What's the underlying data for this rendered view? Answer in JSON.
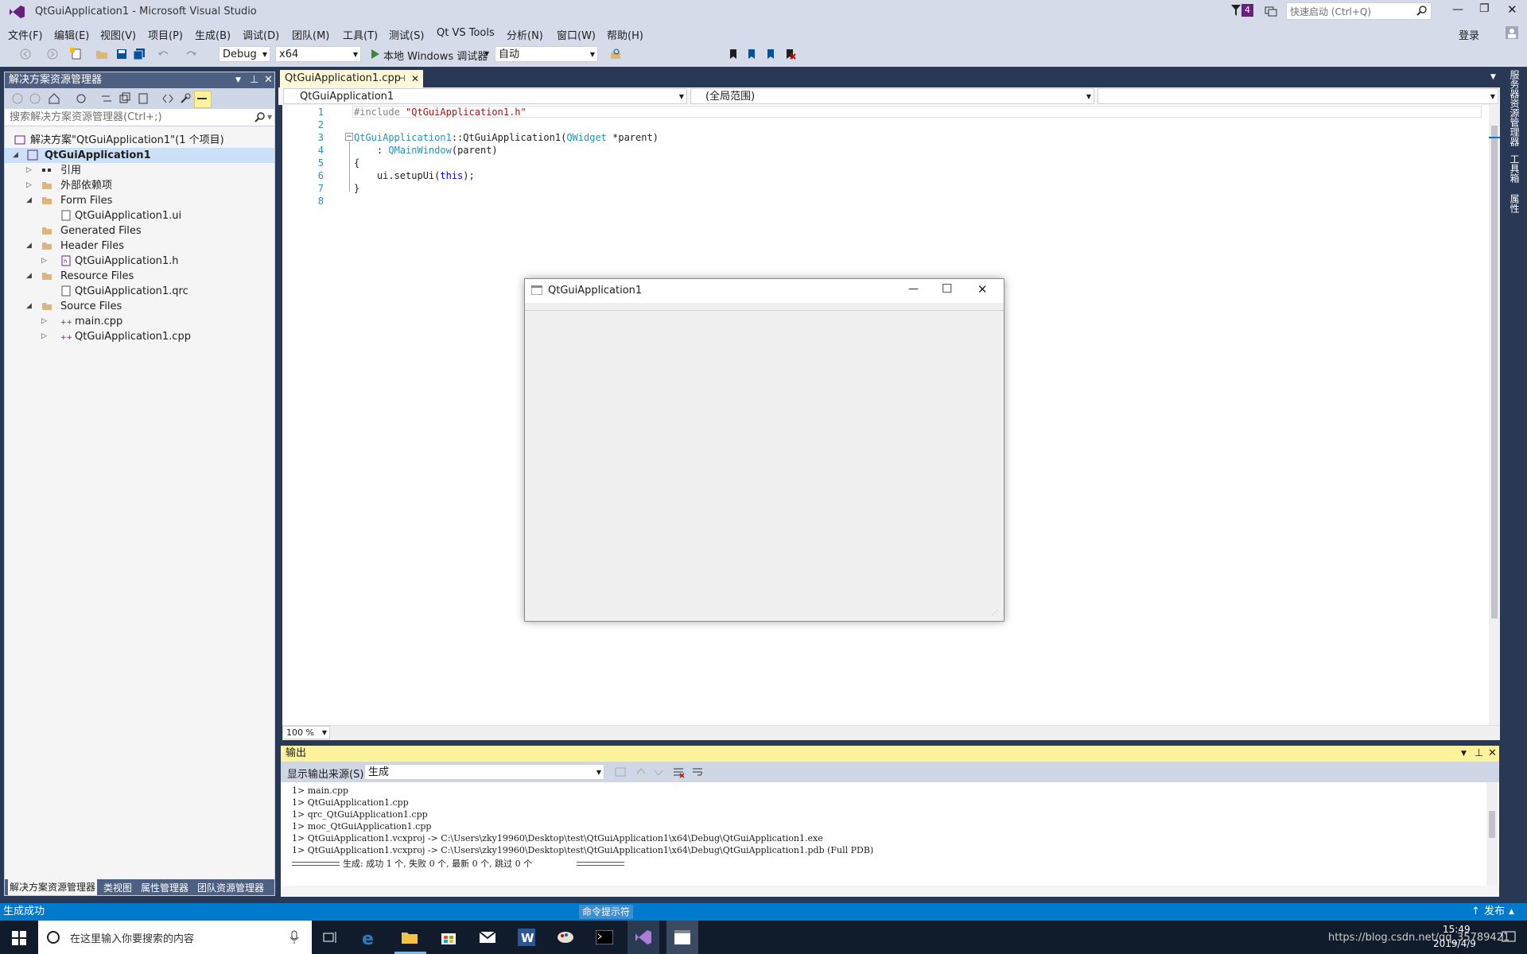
{
  "window": {
    "title": "QtGuiApplication1 - Microsoft Visual Studio",
    "notif_count": "4",
    "quick_launch_placeholder": "快速启动 (Ctrl+Q)",
    "login": "登录"
  },
  "menu": [
    "文件(F)",
    "编辑(E)",
    "视图(V)",
    "项目(P)",
    "生成(B)",
    "调试(D)",
    "团队(M)",
    "工具(T)",
    "测试(S)",
    "Qt VS Tools",
    "分析(N)",
    "窗口(W)",
    "帮助(H)"
  ],
  "toolbar": {
    "config": "Debug",
    "platform": "x64",
    "debugger": "本地 Windows 调试器",
    "auto": "自动"
  },
  "solution_explorer": {
    "title": "解决方案资源管理器",
    "search_placeholder": "搜索解决方案资源管理器(Ctrl+;)",
    "items": [
      {
        "label": "解决方案\"QtGuiApplication1\"(1 个项目)"
      },
      {
        "label": "QtGuiApplication1"
      },
      {
        "label": "引用"
      },
      {
        "label": "外部依赖项"
      },
      {
        "label": "Form Files"
      },
      {
        "label": "QtGuiApplication1.ui"
      },
      {
        "label": "Generated Files"
      },
      {
        "label": "Header Files"
      },
      {
        "label": "QtGuiApplication1.h"
      },
      {
        "label": "Resource Files"
      },
      {
        "label": "QtGuiApplication1.qrc"
      },
      {
        "label": "Source Files"
      },
      {
        "label": "main.cpp"
      },
      {
        "label": "QtGuiApplication1.cpp"
      }
    ],
    "bottom_tabs": [
      "解决方案资源管理器",
      "类视图",
      "属性管理器",
      "团队资源管理器"
    ]
  },
  "editor": {
    "tab_label": "QtGuiApplication1.cpp",
    "nav_project": "QtGuiApplication1",
    "nav_scope": "(全局范围)",
    "zoom": "100 %",
    "line_numbers": [
      "1",
      "2",
      "3",
      "4",
      "5",
      "6",
      "7",
      "8"
    ],
    "code": {
      "l1_pp": "#include ",
      "l1_str": "\"QtGuiApplication1.h\"",
      "l3_a": "QtGuiApplication1",
      "l3_b": "::QtGuiApplication1(",
      "l3_c": "QWidget",
      "l3_d": " *parent)",
      "l4_a": "    : ",
      "l4_b": "QMainWindow",
      "l4_c": "(parent)",
      "l5": "{",
      "l6_a": "    ui.setupUi(",
      "l6_b": "this",
      "l6_c": ");",
      "l7": "}"
    }
  },
  "right_sidebar": [
    "服务器资源管理器",
    "工具箱",
    "属性"
  ],
  "qt_window": {
    "title": "QtGuiApplication1"
  },
  "output": {
    "title": "输出",
    "source_label": "显示输出来源(S):",
    "source_value": "生成",
    "lines": [
      "1>  main.cpp",
      "1>  QtGuiApplication1.cpp",
      "1>  qrc_QtGuiApplication1.cpp",
      "1>  moc_QtGuiApplication1.cpp",
      "1>  QtGuiApplication1.vcxproj -> C:\\Users\\zky19960\\Desktop\\test\\QtGuiApplication1\\x64\\Debug\\QtGuiApplication1.exe",
      "1>  QtGuiApplication1.vcxproj -> C:\\Users\\zky19960\\Desktop\\test\\QtGuiApplication1\\x64\\Debug\\QtGuiApplication1.pdb (Full PDB)"
    ],
    "summary": "生成: 成功 1 个, 失败 0 个, 最新 0 个, 跳过 0 个"
  },
  "status": {
    "left": "生成成功",
    "center": "命令提示符",
    "publish": "发布"
  },
  "taskbar": {
    "search_placeholder": "在这里输入你要搜索的内容",
    "time": "15:49",
    "date": "2019/4/9",
    "watermark": "https://blog.csdn.net/qq_35789421"
  }
}
